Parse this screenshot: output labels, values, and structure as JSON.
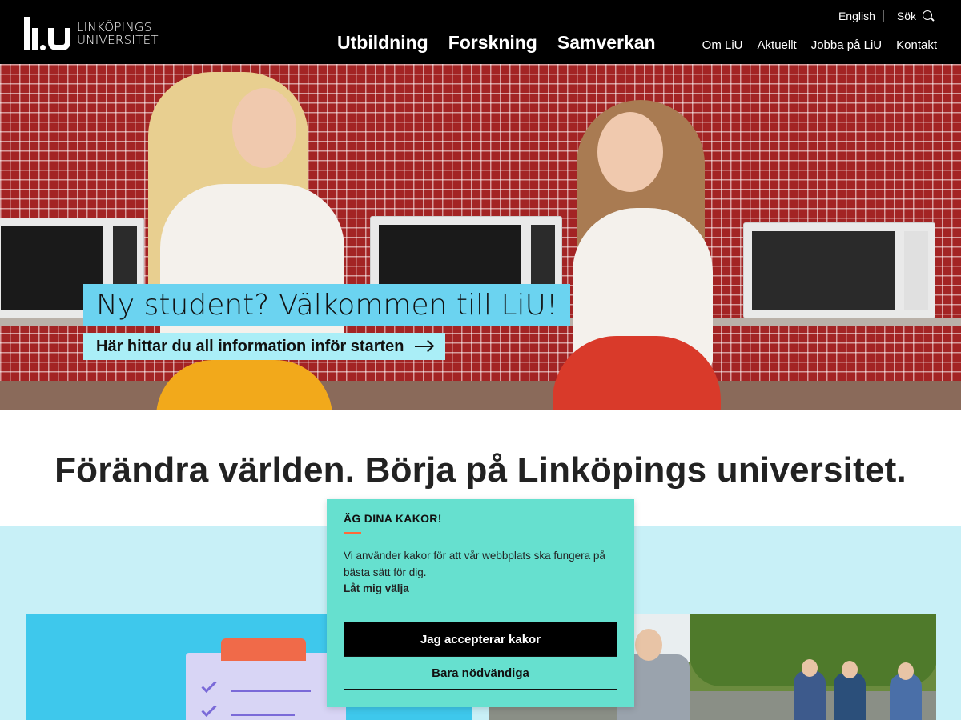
{
  "header": {
    "logo": {
      "line1": "LINKÖPINGS",
      "line2": "UNIVERSITET",
      "mark": "liu-logo-mark"
    },
    "top_links": {
      "language": "English",
      "search": "Sök"
    },
    "main_nav": [
      "Utbildning",
      "Forskning",
      "Samverkan"
    ],
    "secondary_nav": [
      "Om LiU",
      "Aktuellt",
      "Jobba på LiU",
      "Kontakt"
    ]
  },
  "hero": {
    "title": "Ny student? Välkommen till LiU!",
    "link_label": "Här hittar du all information inför starten",
    "link_icon": "arrow-right-icon"
  },
  "headline": "Förändra världen. Börja på Linköpings universitet.",
  "cookie_dialog": {
    "title": "ÄG DINA KAKOR!",
    "text": "Vi använder kakor för att vår webbplats ska fungera på bästa sätt för dig.",
    "choose_link": "Låt mig välja",
    "accept_label": "Jag accepterar kakor",
    "necessary_label": "Bara nödvändiga"
  },
  "colors": {
    "header_bg": "#000000",
    "hero_title_bg": "#6bd3f0",
    "hero_link_bg": "#aaeef7",
    "section_bg": "#c8f0f7",
    "cookie_bg": "#66e0cf",
    "cookie_accent": "#ff6a39"
  }
}
